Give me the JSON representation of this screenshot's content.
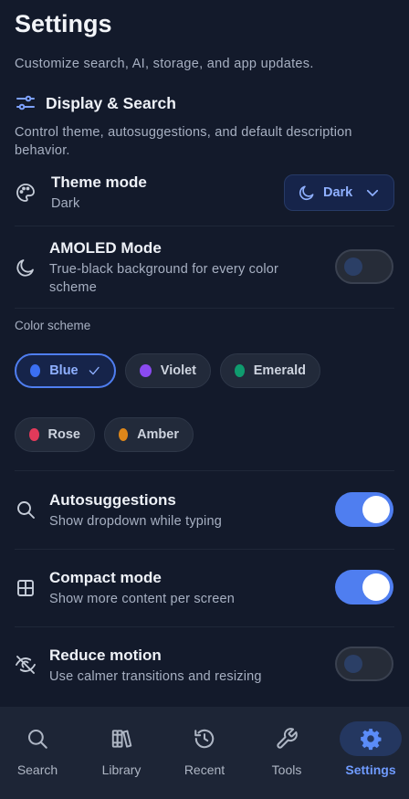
{
  "header": {
    "title": "Settings",
    "subtitle": "Customize search, AI, storage, and app updates."
  },
  "section": {
    "icon": "sliders-icon",
    "title": "Display & Search",
    "description": "Control theme, autosuggestions, and default description behavior."
  },
  "theme_mode": {
    "icon": "palette-icon",
    "title": "Theme mode",
    "value": "Dark",
    "select_label": "Dark",
    "select_icon": "moon-icon"
  },
  "amoled": {
    "icon": "moon-icon",
    "title": "AMOLED Mode",
    "description": "True-black background for every color scheme",
    "enabled": false
  },
  "color_scheme": {
    "label": "Color scheme",
    "selected": "Blue",
    "options": [
      {
        "name": "Blue",
        "color": "#3b6ff2"
      },
      {
        "name": "Violet",
        "color": "#8a4af0"
      },
      {
        "name": "Emerald",
        "color": "#0f9b6e"
      },
      {
        "name": "Rose",
        "color": "#e23a5a"
      },
      {
        "name": "Amber",
        "color": "#dd861a"
      }
    ]
  },
  "autosuggestions": {
    "icon": "search-icon",
    "title": "Autosuggestions",
    "description": "Show dropdown while typing",
    "enabled": true
  },
  "compact": {
    "icon": "grid-icon",
    "title": "Compact mode",
    "description": "Show more content per screen",
    "enabled": true
  },
  "reduce_motion": {
    "icon": "eye-off-icon",
    "title": "Reduce motion",
    "description": "Use calmer transitions and resizing",
    "enabled": false
  },
  "nav": {
    "active": "Settings",
    "items": [
      {
        "label": "Search",
        "icon": "search-icon"
      },
      {
        "label": "Library",
        "icon": "books-icon"
      },
      {
        "label": "Recent",
        "icon": "history-icon"
      },
      {
        "label": "Tools",
        "icon": "wrench-icon"
      },
      {
        "label": "Settings",
        "icon": "gear-icon"
      }
    ]
  },
  "colors": {
    "background": "#131a2b",
    "accent": "#4f7ef0",
    "nav_background": "#1d2536"
  }
}
